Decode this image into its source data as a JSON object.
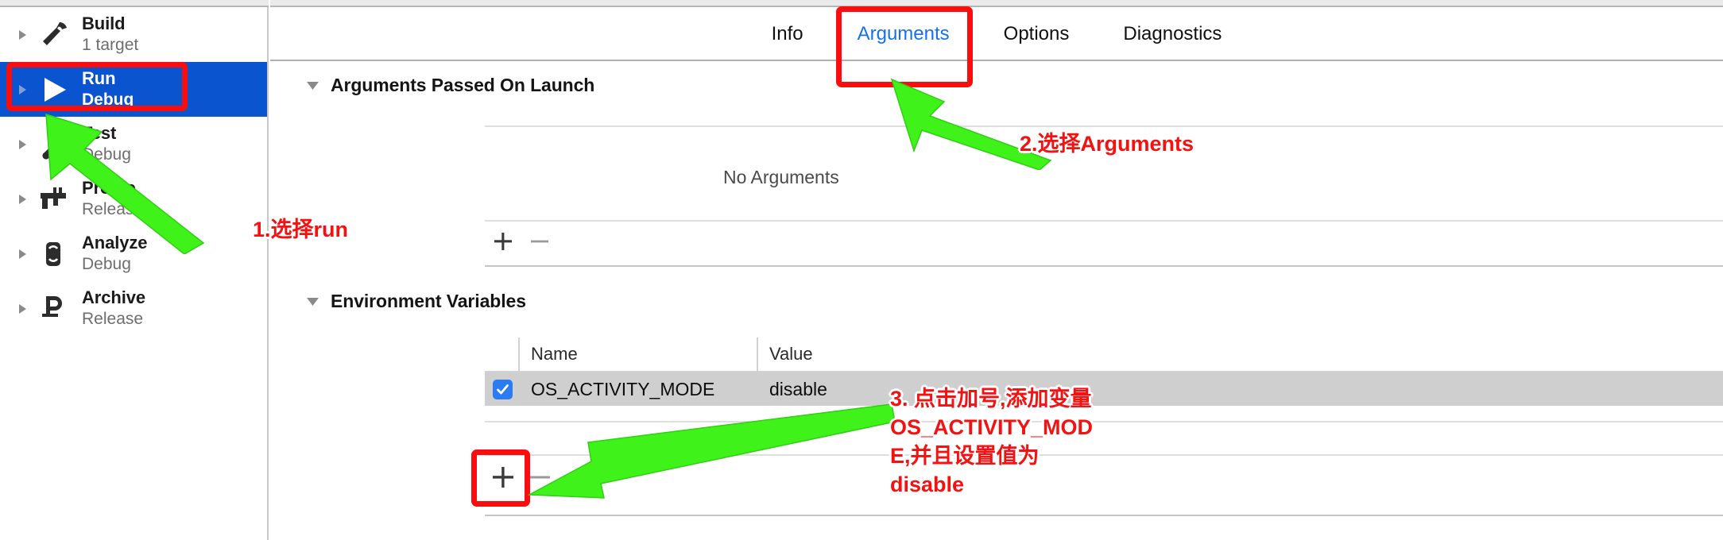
{
  "app": {
    "context": "xcode-scheme-editor"
  },
  "sidebar": {
    "items": [
      {
        "icon": "hammer-icon",
        "title": "Build",
        "subtitle": "1 target",
        "selected": false
      },
      {
        "icon": "play-icon",
        "title": "Run",
        "subtitle": "Debug",
        "selected": true
      },
      {
        "icon": "wrench-icon",
        "title": "Test",
        "subtitle": "Debug",
        "selected": false
      },
      {
        "icon": "caliper-icon",
        "title": "Profile",
        "subtitle": "Release",
        "selected": false
      },
      {
        "icon": "analyze-icon",
        "title": "Analyze",
        "subtitle": "Debug",
        "selected": false
      },
      {
        "icon": "archive-icon",
        "title": "Archive",
        "subtitle": "Release",
        "selected": false
      }
    ]
  },
  "tabs": [
    {
      "label": "Info",
      "active": false
    },
    {
      "label": "Arguments",
      "active": true
    },
    {
      "label": "Options",
      "active": false
    },
    {
      "label": "Diagnostics",
      "active": false
    }
  ],
  "arguments_section": {
    "title": "Arguments Passed On Launch",
    "empty_text": "No Arguments",
    "add_button_label": "+",
    "remove_button_label": "–"
  },
  "environment_section": {
    "title": "Environment Variables",
    "columns": [
      "Name",
      "Value"
    ],
    "rows": [
      {
        "checked": true,
        "name": "OS_ACTIVITY_MODE",
        "value": "disable"
      }
    ],
    "add_button_label": "+",
    "remove_button_label": "–"
  },
  "annotations": {
    "step1": "1.选择run",
    "step2": "2.选择Arguments",
    "step3_line1": "3. 点击加号,添加变量",
    "step3_line2": "OS_ACTIVITY_MOD",
    "step3_line3": "E,并且设置值为",
    "step3_line4": "disable"
  },
  "colors": {
    "selection_blue": "#0a54cf",
    "tab_active_blue": "#1771e6",
    "annotation_red": "#f41111",
    "annotation_green": "#3ff219",
    "checkbox_blue": "#2b7bf3",
    "row_highlight": "#cfcfcf"
  }
}
